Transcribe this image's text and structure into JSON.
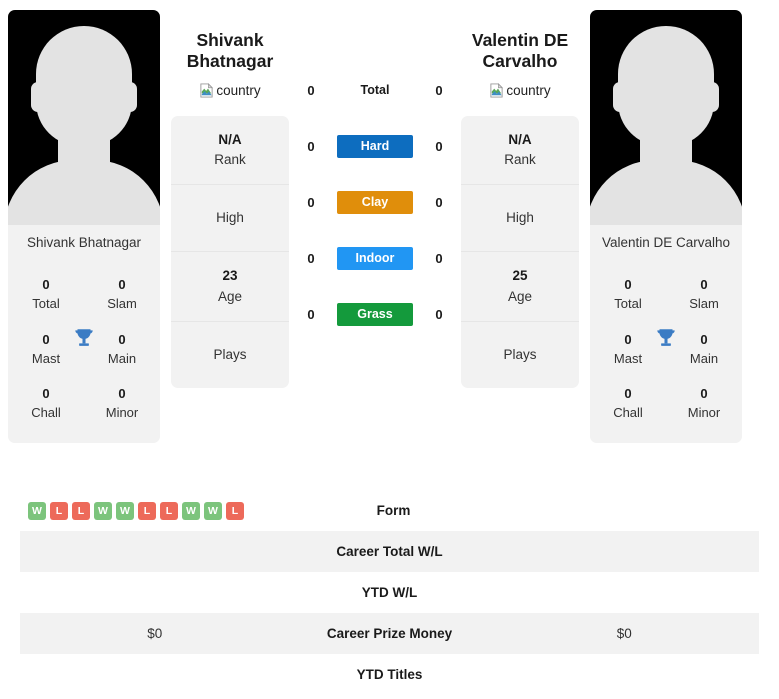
{
  "players": {
    "left": {
      "name": "Shivank Bhatnagar",
      "name_line1": "Shivank",
      "name_line2": "Bhatnagar",
      "country_alt": "country",
      "photo_caption": "Shivank Bhatnagar",
      "titles": {
        "total_value": "0",
        "total_label": "Total",
        "slam_value": "0",
        "slam_label": "Slam",
        "mast_value": "0",
        "mast_label": "Mast",
        "main_value": "0",
        "main_label": "Main",
        "chall_value": "0",
        "chall_label": "Chall",
        "minor_value": "0",
        "minor_label": "Minor"
      },
      "info": {
        "rank_value": "N/A",
        "rank_label": "Rank",
        "high_label": "High",
        "age_value": "23",
        "age_label": "Age",
        "plays_label": "Plays"
      },
      "surface_wins": {
        "total": "0",
        "hard": "0",
        "clay": "0",
        "indoor": "0",
        "grass": "0"
      },
      "form": [
        "W",
        "L",
        "L",
        "W",
        "W",
        "L",
        "L",
        "W",
        "W",
        "L"
      ],
      "career_total_wl": "",
      "ytd_wl": "",
      "career_prize_money": "$0",
      "ytd_titles": ""
    },
    "right": {
      "name": "Valentin DE Carvalho",
      "name_line1": "Valentin DE",
      "name_line2": "Carvalho",
      "country_alt": "country",
      "photo_caption": "Valentin DE Carvalho",
      "titles": {
        "total_value": "0",
        "total_label": "Total",
        "slam_value": "0",
        "slam_label": "Slam",
        "mast_value": "0",
        "mast_label": "Mast",
        "main_value": "0",
        "main_label": "Main",
        "chall_value": "0",
        "chall_label": "Chall",
        "minor_value": "0",
        "minor_label": "Minor"
      },
      "info": {
        "rank_value": "N/A",
        "rank_label": "Rank",
        "high_label": "High",
        "age_value": "25",
        "age_label": "Age",
        "plays_label": "Plays"
      },
      "surface_wins": {
        "total": "0",
        "hard": "0",
        "clay": "0",
        "indoor": "0",
        "grass": "0"
      },
      "form": [],
      "career_total_wl": "",
      "ytd_wl": "",
      "career_prize_money": "$0",
      "ytd_titles": ""
    }
  },
  "surfaces": {
    "total_label": "Total",
    "hard_label": "Hard",
    "clay_label": "Clay",
    "indoor_label": "Indoor",
    "grass_label": "Grass"
  },
  "comparison_rows": {
    "form_label": "Form",
    "career_total_wl_label": "Career Total W/L",
    "ytd_wl_label": "YTD W/L",
    "career_prize_money_label": "Career Prize Money",
    "ytd_titles_label": "YTD Titles"
  },
  "colors": {
    "hard": "#0d6dbf",
    "clay": "#e08e0b",
    "indoor": "#2196f3",
    "grass": "#149a3c",
    "win": "#7cc47c",
    "loss": "#ed6a5a",
    "trophy": "#3b7cc4",
    "panel_bg": "#f2f2f2"
  }
}
